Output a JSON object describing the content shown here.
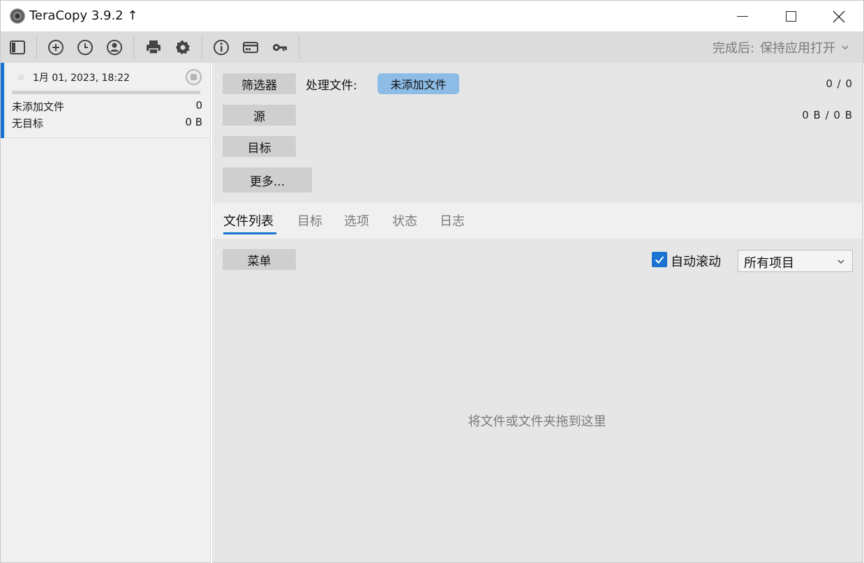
{
  "window": {
    "title": "TeraCopy 3.9.2 ↑"
  },
  "toolbar": {
    "icons": [
      "sidebar-toggle-icon",
      "add-icon",
      "history-icon",
      "account-icon",
      "print-icon",
      "settings-icon",
      "info-icon",
      "card-icon",
      "key-icon"
    ],
    "after_done_label": "完成后:",
    "after_done_value": "保持应用打开"
  },
  "job": {
    "date": "1月 01, 2023, 18:22",
    "row1_label": "未添加文件",
    "row1_value": "0",
    "row2_label": "无目标",
    "row2_value": "0 B"
  },
  "panel": {
    "filter_button": "筛选器",
    "process_label": "处理文件:",
    "no_files_pill": "未添加文件",
    "file_count": "0 / 0",
    "source_button": "源",
    "size_count": "0 B / 0 B",
    "target_button": "目标",
    "more_button": "更多..."
  },
  "tabs": [
    "文件列表",
    "目标",
    "选项",
    "状态",
    "日志"
  ],
  "list": {
    "menu_button": "菜单",
    "autoscroll_label": "自动滚动",
    "autoscroll_checked": true,
    "filter_select": "所有项目",
    "drop_hint": "将文件或文件夹拖到这里"
  },
  "colors": {
    "accent": "#1a73d1",
    "pill": "#8dbde6"
  }
}
